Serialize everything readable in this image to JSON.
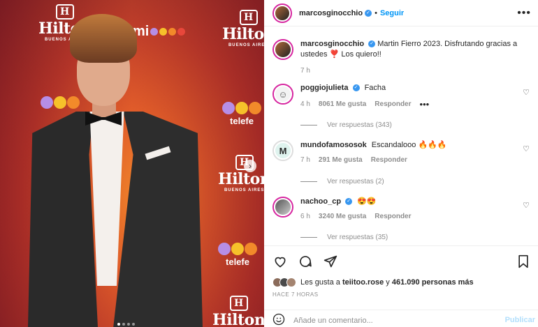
{
  "photo": {
    "hilton_name": "Hilton",
    "hilton_city": "BUENOS AIRES",
    "telefe": "telefe",
    "mioo": "mi",
    "dot_colors": [
      "#b68ee6",
      "#f6c12a",
      "#f28a2a",
      "#e8473b"
    ]
  },
  "post": {
    "username": "marcosginocchio",
    "follow_label": "Seguir",
    "more_label": "•••",
    "caption_text": "Martin Fierro 2023. Disfrutando gracias a ustedes ❣️ Los quiero!!",
    "caption_time": "7 h"
  },
  "comments": [
    {
      "username": "poggiojulieta",
      "verified": true,
      "text": "Facha",
      "time": "4 h",
      "likes": "8061 Me gusta",
      "reply": "Responder",
      "more": "•••",
      "replies": "Ver respuestas (343)"
    },
    {
      "username": "mundofamososok",
      "verified": false,
      "text": "Escandalooo 🔥🔥🔥",
      "time": "7 h",
      "likes": "291 Me gusta",
      "reply": "Responder",
      "replies": "Ver respuestas (2)"
    },
    {
      "username": "nachoo_cp",
      "verified": true,
      "text": "😍😍",
      "time": "6 h",
      "likes": "3240 Me gusta",
      "reply": "Responder",
      "replies": "Ver respuestas (35)"
    }
  ],
  "likes": {
    "prefix": "Les gusta a",
    "user": "teiitoo.rose",
    "conj": "y",
    "count": "461.090 personas más"
  },
  "time_ago": "HACE 7 HORAS",
  "add_comment": {
    "placeholder": "Añade un comentario...",
    "publish_label": "Publicar"
  },
  "colors": {
    "accent": "#0095f6",
    "verified": "#3897f0",
    "muted": "#8e8e8e"
  }
}
